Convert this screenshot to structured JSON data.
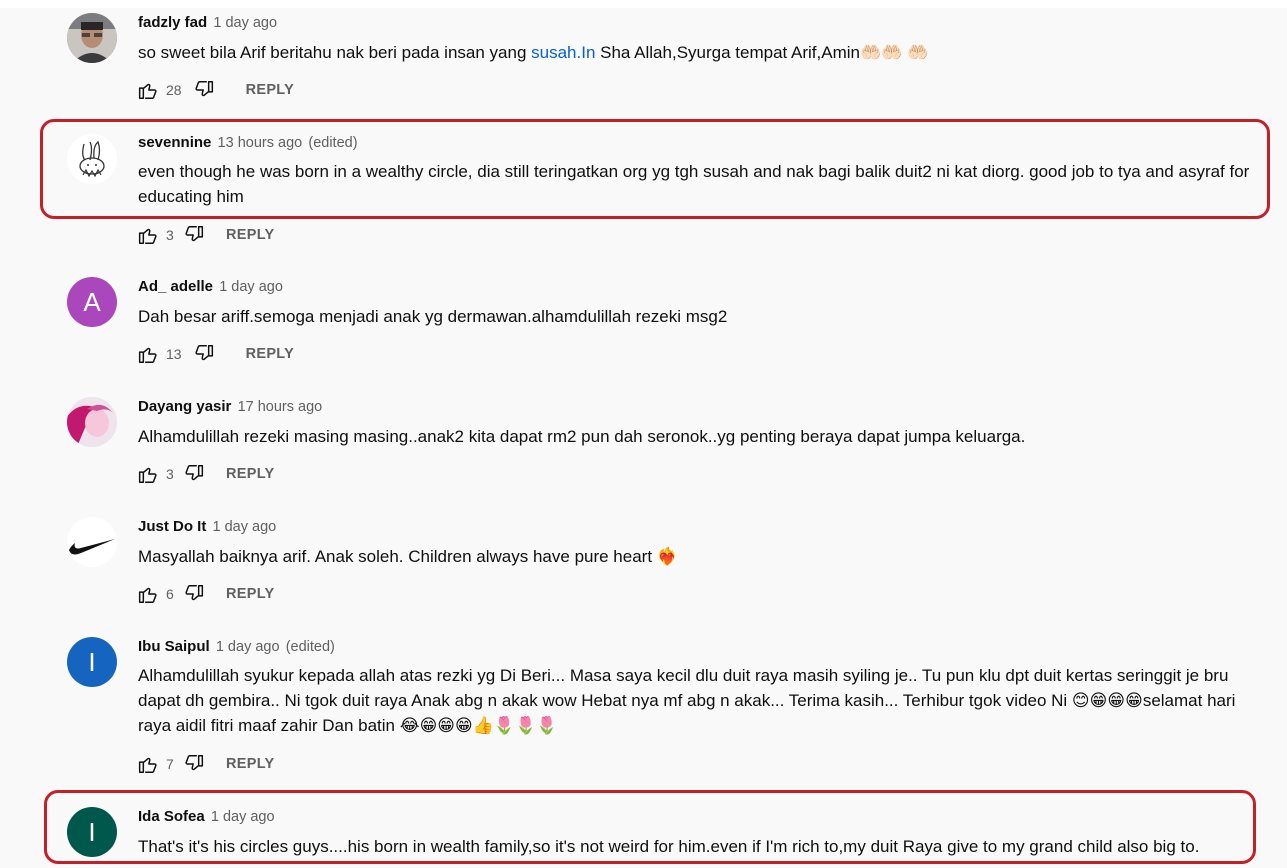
{
  "colors": {
    "accent_border": "#c4202a",
    "link": "#065fd4",
    "secondary_text": "#606060"
  },
  "comments": [
    {
      "author": "fadzly fad",
      "time": "1 day ago",
      "edited": "",
      "text_before": "so sweet bila Arif beritahu nak beri pada insan yang ",
      "link": "susah.In",
      "text_after": " Sha Allah,Syurga tempat Arif,Amin🤲🏻🤲🏻 🤲🏻",
      "likes": "28",
      "reply": "REPLY",
      "avatar_icon": "user-photo-avatar"
    },
    {
      "author": "sevennine",
      "time": "13 hours ago",
      "edited": "(edited)",
      "text": "even though he was born in a wealthy circle, dia still teringatkan org yg tgh susah and nak bagi balik duit2 ni kat diorg. good job to tya and asyraf for educating him",
      "likes": "3",
      "reply": "REPLY",
      "avatar_icon": "bunny-drawing-avatar"
    },
    {
      "author": "Ad_ adelle",
      "time": "1 day ago",
      "edited": "",
      "text": "Dah besar ariff.semoga menjadi anak yg dermawan.alhamdulillah rezeki msg2",
      "likes": "13",
      "reply": "REPLY",
      "avatar_letter": "A",
      "avatar_color": "#ab47bc"
    },
    {
      "author": "Dayang yasir",
      "time": "17 hours ago",
      "edited": "",
      "text": "Alhamdulillah rezeki masing masing..anak2 kita dapat rm2 pun dah seronok..yg penting beraya dapat jumpa keluarga.",
      "likes": "3",
      "reply": "REPLY",
      "avatar_icon": "pink-photo-avatar"
    },
    {
      "author": "Just Do It",
      "time": "1 day ago",
      "edited": "",
      "text": "Masyallah baiknya arif. Anak soleh. Children always have pure heart ❤️‍🔥",
      "likes": "6",
      "reply": "REPLY",
      "avatar_icon": "swoosh-logo-avatar"
    },
    {
      "author": "Ibu Saipul",
      "time": "1 day ago",
      "edited": "(edited)",
      "text": "Alhamdulillah syukur kepada allah atas rezki yg Di Beri... Masa saya kecil dlu duit raya masih syiling je.. Tu pun klu dpt duit kertas seringgit je bru dapat dh gembira.. Ni tgok duit raya Anak abg n akak wow Hebat nya mf abg n akak... Terima kasih... Terhibur tgok video Ni 😊😁😁😁selamat hari raya aidil fitri maaf zahir Dan batin 😂😁😁😁👍🌷🌷🌷",
      "likes": "7",
      "reply": "REPLY",
      "avatar_letter": "I",
      "avatar_color": "#1565c0"
    },
    {
      "author": "Ida Sofea",
      "time": "1 day ago",
      "edited": "",
      "text": "That's it's his circles guys....his born in wealth family,so it's not weird for him.even if I'm rich to,my duit Raya give to my grand child also big to.",
      "avatar_letter": "I",
      "avatar_color": "#00574b"
    }
  ]
}
